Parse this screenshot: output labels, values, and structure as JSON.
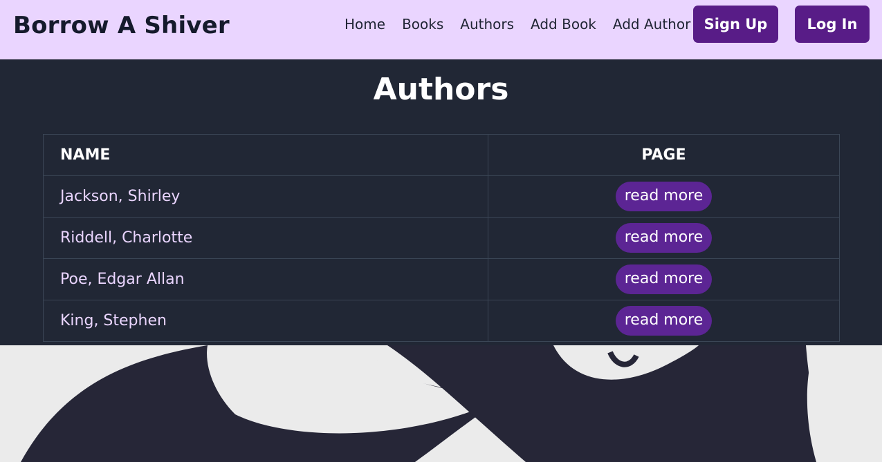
{
  "navbar": {
    "brand": "Borrow A Shiver",
    "links": [
      "Home",
      "Books",
      "Authors",
      "Add Book",
      "Add Author"
    ],
    "signup_label": "Sign Up",
    "login_label": "Log In"
  },
  "main": {
    "title": "Authors",
    "table": {
      "headers": [
        "NAME",
        "PAGE"
      ],
      "rows": [
        {
          "name": "Jackson, Shirley",
          "action": "read more"
        },
        {
          "name": "Riddell, Charlotte",
          "action": "read more"
        },
        {
          "name": "Poe, Edgar Allan",
          "action": "read more"
        },
        {
          "name": "King, Stephen",
          "action": "read more"
        }
      ]
    }
  },
  "colors": {
    "navbar_bg": "#ead5ff",
    "button_bg": "#581c87",
    "panel_bg": "#111827",
    "page_bg": "#ebebeb",
    "ghost_shape": "#262637"
  }
}
